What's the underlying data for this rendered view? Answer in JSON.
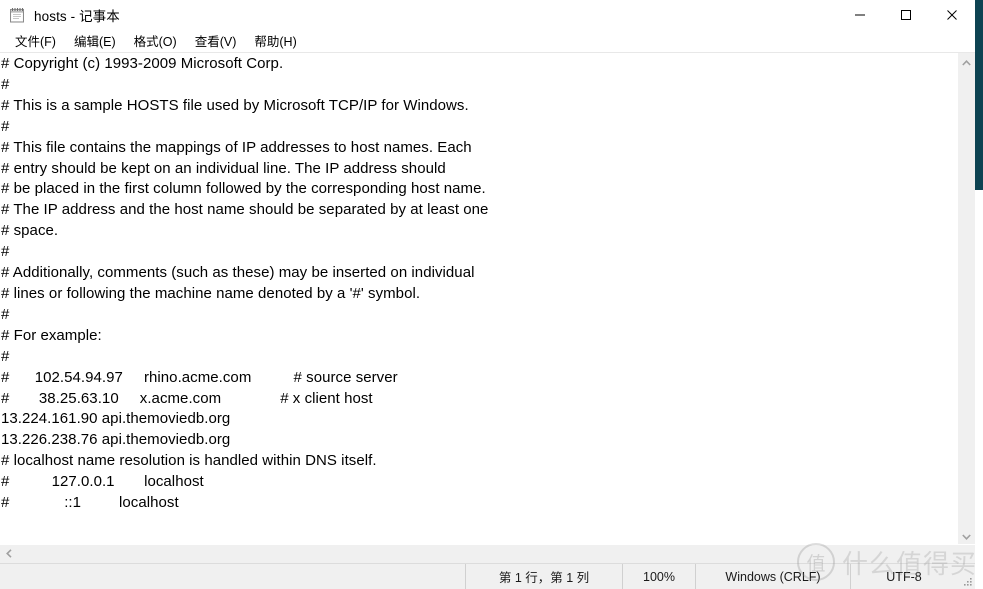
{
  "window": {
    "title": "hosts - 记事本",
    "app_icon": "notepad-icon",
    "caption": {
      "minimize_label": "最小化",
      "maximize_label": "最大化",
      "close_label": "关闭"
    }
  },
  "menubar": {
    "items": [
      {
        "label": "文件(F)",
        "name": "menu-file"
      },
      {
        "label": "编辑(E)",
        "name": "menu-edit"
      },
      {
        "label": "格式(O)",
        "name": "menu-format"
      },
      {
        "label": "查看(V)",
        "name": "menu-view"
      },
      {
        "label": "帮助(H)",
        "name": "menu-help"
      }
    ]
  },
  "editor": {
    "content": "# Copyright (c) 1993-2009 Microsoft Corp.\n#\n# This is a sample HOSTS file used by Microsoft TCP/IP for Windows.\n#\n# This file contains the mappings of IP addresses to host names. Each\n# entry should be kept on an individual line. The IP address should\n# be placed in the first column followed by the corresponding host name.\n# The IP address and the host name should be separated by at least one\n# space.\n#\n# Additionally, comments (such as these) may be inserted on individual\n# lines or following the machine name denoted by a '#' symbol.\n#\n# For example:\n#\n#      102.54.94.97     rhino.acme.com          # source server\n#       38.25.63.10     x.acme.com              # x client host\n13.224.161.90 api.themoviedb.org\n13.226.238.76 api.themoviedb.org\n# localhost name resolution is handled within DNS itself.\n#          127.0.0.1       localhost\n#             ::1         localhost",
    "lines": [
      "# Copyright (c) 1993-2009 Microsoft Corp.",
      "#",
      "# This is a sample HOSTS file used by Microsoft TCP/IP for Windows.",
      "#",
      "# This file contains the mappings of IP addresses to host names. Each",
      "# entry should be kept on an individual line. The IP address should",
      "# be placed in the first column followed by the corresponding host name.",
      "# The IP address and the host name should be separated by at least one",
      "# space.",
      "#",
      "# Additionally, comments (such as these) may be inserted on individual",
      "# lines or following the machine name denoted by a '#' symbol.",
      "#",
      "# For example:",
      "#",
      "#      102.54.94.97     rhino.acme.com          # source server",
      "#       38.25.63.10     x.acme.com              # x client host",
      "13.224.161.90 api.themoviedb.org",
      "13.226.238.76 api.themoviedb.org",
      "# localhost name resolution is handled within DNS itself.",
      "#          127.0.0.1       localhost",
      "#             ::1         localhost"
    ]
  },
  "scrollbars": {
    "vertical": {
      "up_arrow": "chevron-up-icon",
      "down_arrow": "chevron-down-icon"
    },
    "horizontal": {
      "left_arrow": "chevron-left-icon"
    }
  },
  "statusbar": {
    "line_col": "第 1 行，第 1 列",
    "zoom": "100%",
    "line_ending": "Windows (CRLF)",
    "encoding": "UTF-8"
  },
  "watermark": {
    "badge": "值",
    "text": "什么值得买"
  },
  "colors": {
    "desktop_strip": "#0d4352",
    "window_bg": "#ffffff",
    "chrome_bg": "#f0f0f0",
    "text": "#000000"
  }
}
